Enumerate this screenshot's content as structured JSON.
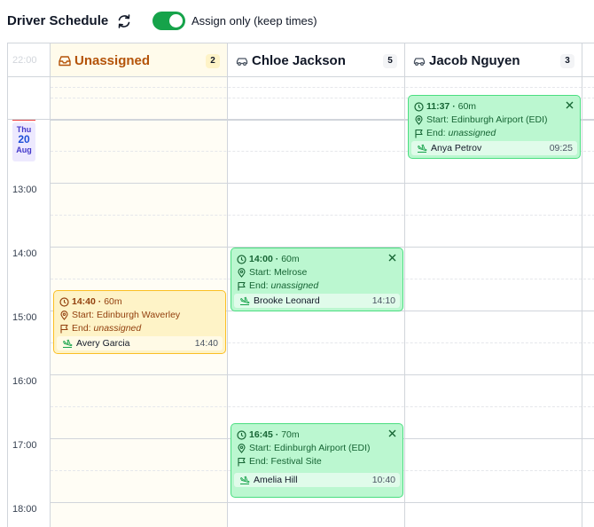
{
  "toolbar": {
    "title": "Driver Schedule",
    "refresh_icon": "refresh-icon",
    "toggle_on": true,
    "toggle_label": "Assign only (keep times)",
    "accent_color": "#16a34a"
  },
  "columns": [
    {
      "name": "Unassigned",
      "count": "2",
      "icon": "inbox-icon"
    },
    {
      "name": "Chloe Jackson",
      "count": "5",
      "icon": "car-icon"
    },
    {
      "name": "Jacob Nguyen",
      "count": "3",
      "icon": "car-icon"
    }
  ],
  "timeline": {
    "prev_hour": "22:00",
    "day": {
      "weekday": "Thu",
      "date": "20",
      "month": "Aug"
    },
    "hours": [
      "13:00",
      "14:00",
      "15:00",
      "16:00",
      "17:00",
      "18:00"
    ]
  },
  "cards": {
    "unassigned_1": {
      "time": "14:40",
      "duration": "60m",
      "start": "Start: Edinburgh Waverley",
      "end_prefix": "End: ",
      "end": "unassigned",
      "passenger": "Avery Garcia",
      "pickup": "14:40",
      "status": "unassigned"
    },
    "chloe_1": {
      "time": "14:00",
      "duration": "60m",
      "start": "Start: Melrose",
      "end_prefix": "End: ",
      "end": "unassigned",
      "passenger": "Brooke Leonard",
      "pickup": "14:10",
      "status": "assigned"
    },
    "chloe_2": {
      "time": "16:45",
      "duration": "70m",
      "start": "Start: Edinburgh Airport (EDI)",
      "end": "End: Festival Site",
      "passenger": "Amelia Hill",
      "pickup": "10:40",
      "status": "assigned"
    },
    "jacob_1": {
      "time": "11:37",
      "duration": "60m",
      "start": "Start: Edinburgh Airport (EDI)",
      "end_prefix": "End: ",
      "end": "unassigned",
      "passenger": "Anya Petrov",
      "pickup": "09:25",
      "status": "assigned"
    }
  },
  "colors": {
    "assigned_bg": "#bbf7d0",
    "unassigned_bg": "#fef3c7",
    "unassigned_header": "#b45309"
  }
}
